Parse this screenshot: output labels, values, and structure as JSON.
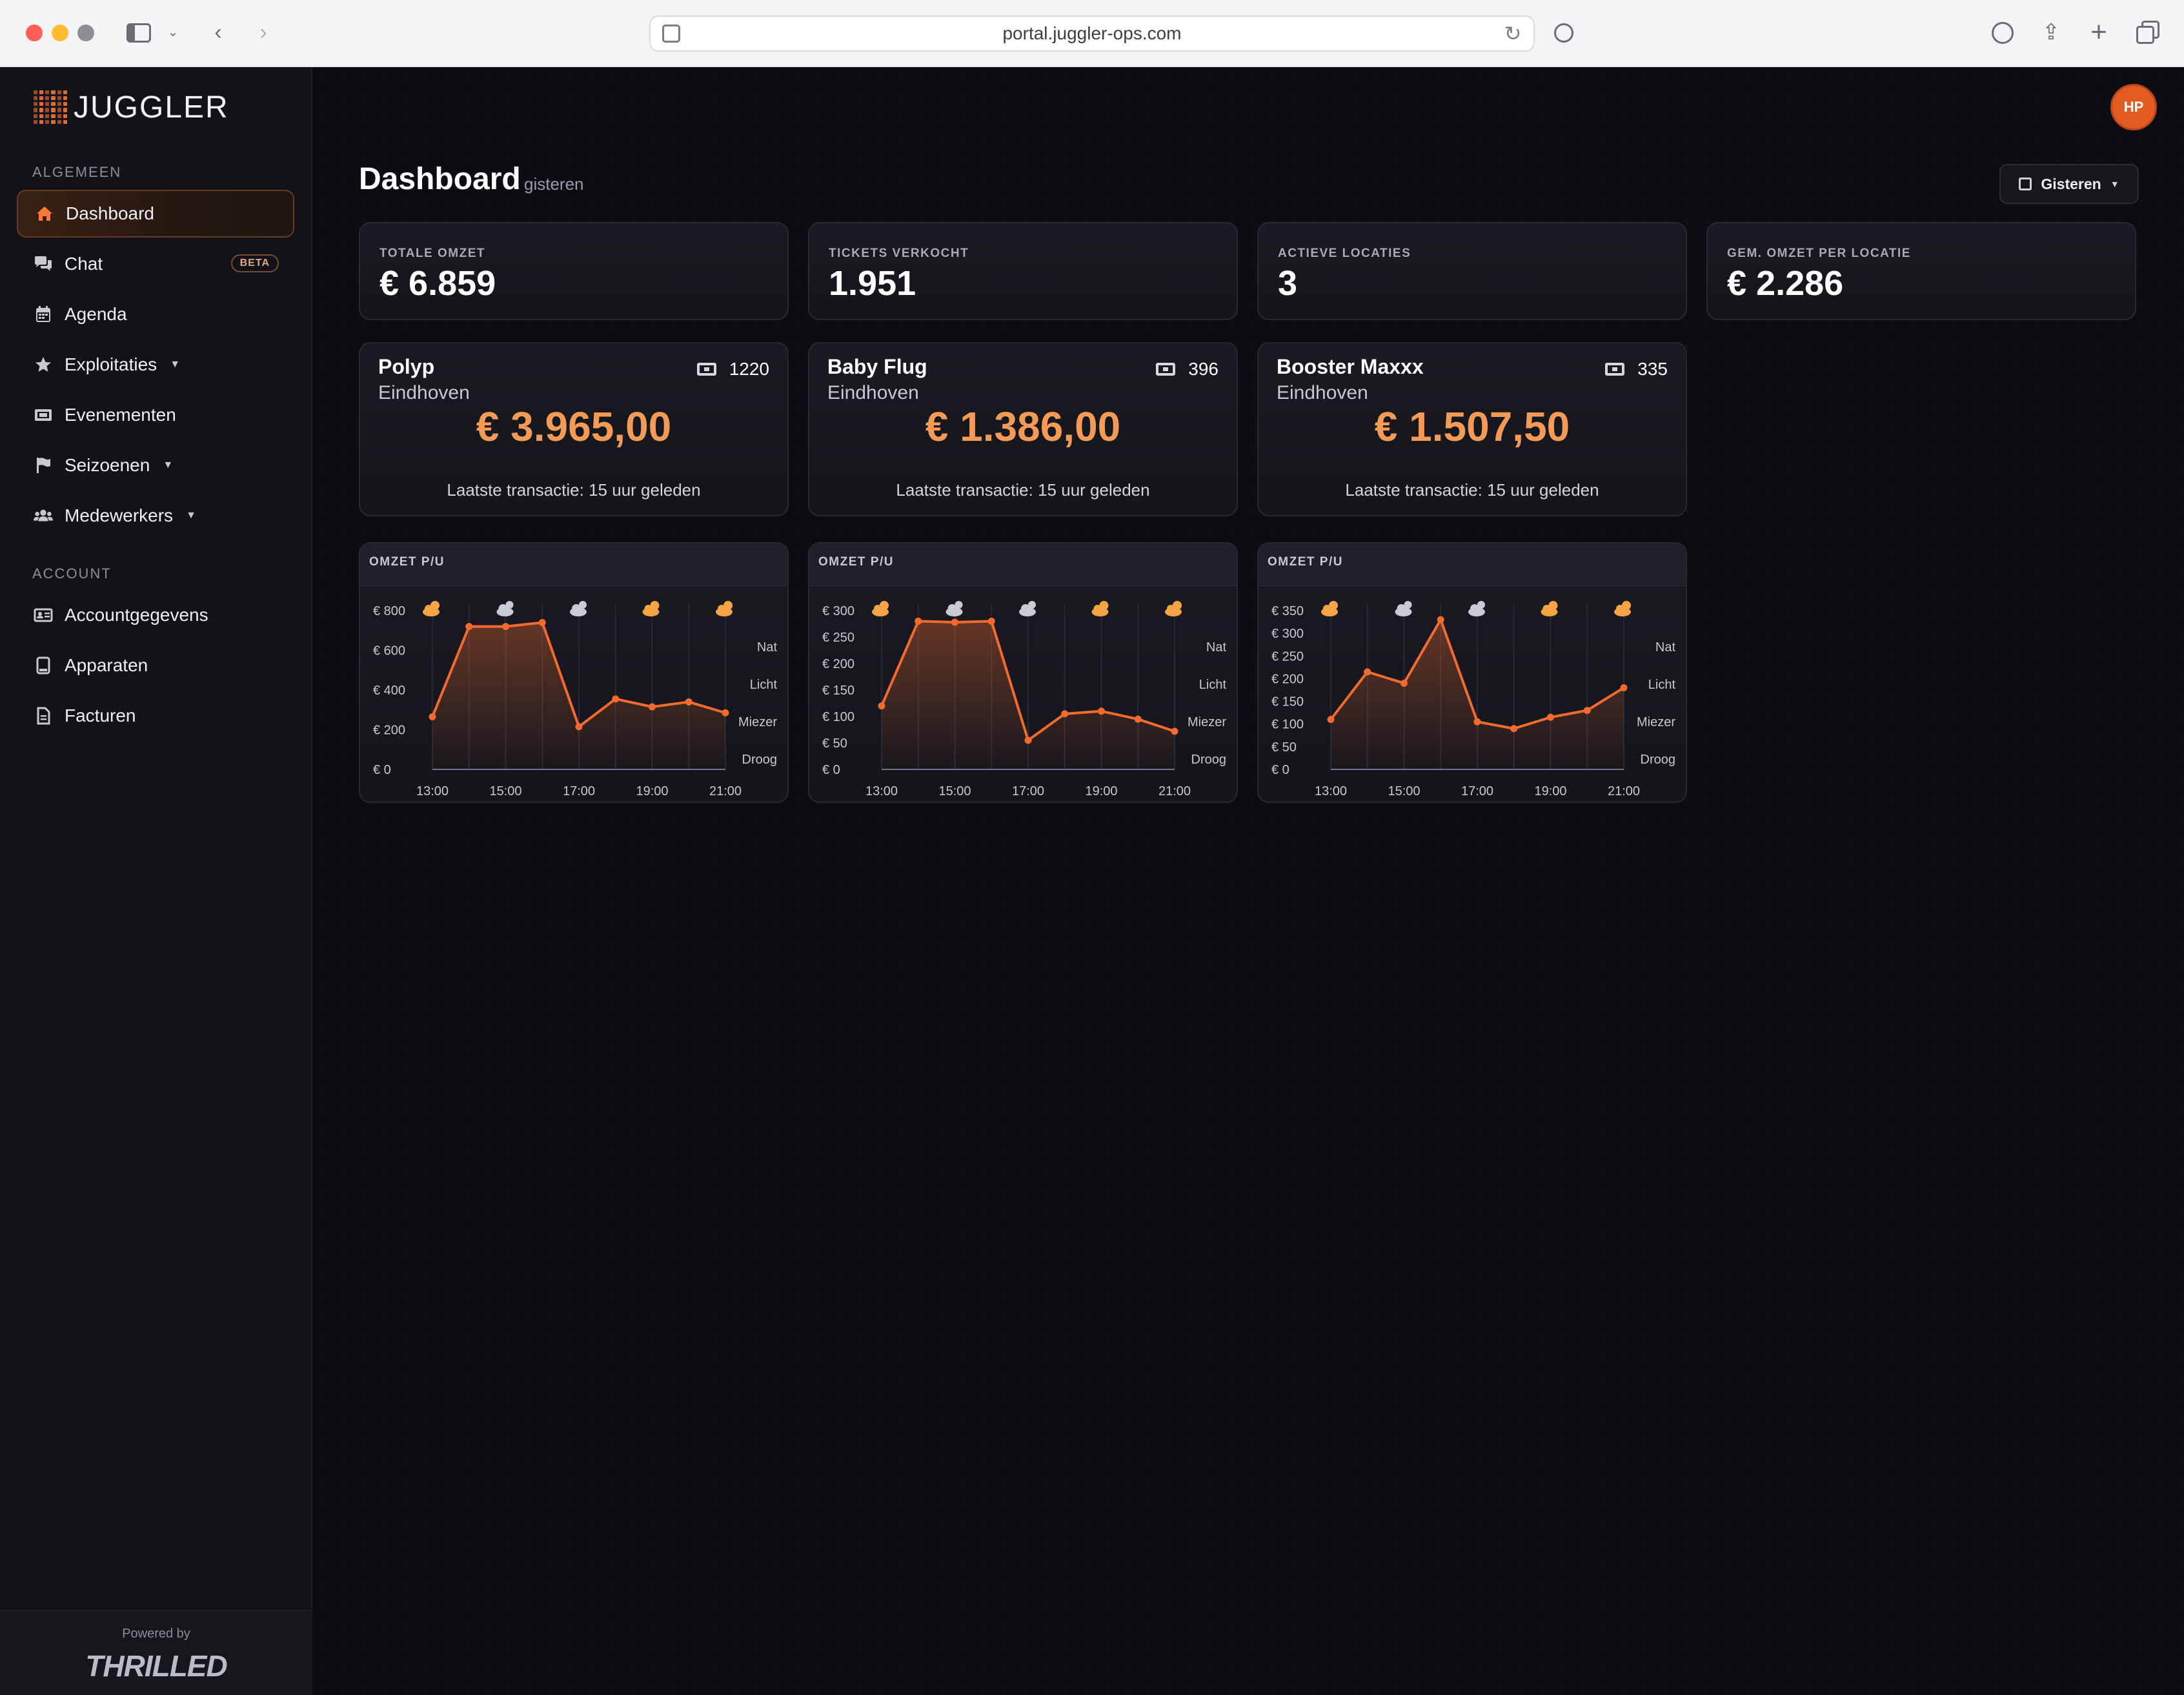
{
  "browser": {
    "url": "portal.juggler-ops.com"
  },
  "sidebar": {
    "logo": "JUGGLER",
    "sections": [
      {
        "title": "ALGEMEEN",
        "items": [
          {
            "label": "Dashboard",
            "icon": "home-icon",
            "active": true
          },
          {
            "label": "Chat",
            "icon": "chat-icon",
            "badge": "BETA"
          },
          {
            "label": "Agenda",
            "icon": "calendar-icon"
          },
          {
            "label": "Exploitaties",
            "icon": "star-icon",
            "dropdown": true
          },
          {
            "label": "Evenementen",
            "icon": "ticket-icon"
          },
          {
            "label": "Seizoenen",
            "icon": "flag-icon",
            "dropdown": true
          },
          {
            "label": "Medewerkers",
            "icon": "users-icon",
            "dropdown": true
          }
        ]
      },
      {
        "title": "ACCOUNT",
        "items": [
          {
            "label": "Accountgegevens",
            "icon": "id-card-icon"
          },
          {
            "label": "Apparaten",
            "icon": "tablet-icon"
          },
          {
            "label": "Facturen",
            "icon": "invoice-icon"
          }
        ]
      }
    ],
    "footer": {
      "powered_by": "Powered by",
      "brand": "THRILLED"
    }
  },
  "header": {
    "avatar_initials": "HP",
    "title": "Dashboard",
    "subtitle": "gisteren",
    "date_button": "Gisteren"
  },
  "kpis": [
    {
      "label": "TOTALE OMZET",
      "value": "€ 6.859"
    },
    {
      "label": "TICKETS VERKOCHT",
      "value": "1.951"
    },
    {
      "label": "ACTIEVE LOCATIES",
      "value": "3"
    },
    {
      "label": "GEM. OMZET PER LOCATIE",
      "value": "€ 2.286"
    }
  ],
  "locations": [
    {
      "name": "Polyp",
      "city": "Eindhoven",
      "tickets": "1220",
      "amount": "€ 3.965,00",
      "last_transaction": "Laatste transactie: 15 uur geleden"
    },
    {
      "name": "Baby Flug",
      "city": "Eindhoven",
      "tickets": "396",
      "amount": "€ 1.386,00",
      "last_transaction": "Laatste transactie: 15 uur geleden"
    },
    {
      "name": "Booster Maxxx",
      "city": "Eindhoven",
      "tickets": "335",
      "amount": "€ 1.507,50",
      "last_transaction": "Laatste transactie: 15 uur geleden"
    }
  ],
  "colors": {
    "accent": "#f39a57",
    "line": "#f26a2e",
    "weather_sun": "#f5a445",
    "weather_cloud": "#c8cad4"
  },
  "chart_data": [
    {
      "type": "area",
      "title": "OMZET P/U",
      "x": [
        "13:00",
        "14:00",
        "15:00",
        "16:00",
        "17:00",
        "18:00",
        "19:00",
        "20:00",
        "21:00"
      ],
      "x_tick_labels": [
        "13:00",
        "15:00",
        "17:00",
        "19:00",
        "21:00"
      ],
      "values": [
        265,
        720,
        720,
        740,
        215,
        355,
        315,
        340,
        285
      ],
      "ylim": [
        0,
        800
      ],
      "y_ticks": [
        0,
        200,
        400,
        600,
        800
      ],
      "y_tick_labels": [
        "€ 0",
        "€ 200",
        "€ 400",
        "€ 600",
        "€ 800"
      ],
      "weather_scale": [
        "Nat",
        "Licht",
        "Miezer",
        "Droog"
      ],
      "weather_icons": [
        "sun-cloud-icon",
        "cloud-sun-icon",
        "cloud-sun-icon",
        "sun-cloud-icon",
        "sun-cloud-icon"
      ],
      "grid": true
    },
    {
      "type": "area",
      "title": "OMZET P/U",
      "x": [
        "13:00",
        "14:00",
        "15:00",
        "16:00",
        "17:00",
        "18:00",
        "19:00",
        "20:00",
        "21:00"
      ],
      "x_tick_labels": [
        "13:00",
        "15:00",
        "17:00",
        "19:00",
        "21:00"
      ],
      "values": [
        120,
        280,
        278,
        280,
        55,
        105,
        110,
        95,
        72
      ],
      "ylim": [
        0,
        300
      ],
      "y_ticks": [
        0,
        50,
        100,
        150,
        200,
        250,
        300
      ],
      "y_tick_labels": [
        "€ 0",
        "€ 50",
        "€ 100",
        "€ 150",
        "€ 200",
        "€ 250",
        "€ 300"
      ],
      "weather_scale": [
        "Nat",
        "Licht",
        "Miezer",
        "Droog"
      ],
      "weather_icons": [
        "sun-cloud-icon",
        "cloud-sun-icon",
        "cloud-sun-icon",
        "sun-cloud-icon",
        "sun-cloud-icon"
      ],
      "grid": true
    },
    {
      "type": "area",
      "title": "OMZET P/U",
      "x": [
        "13:00",
        "14:00",
        "15:00",
        "16:00",
        "17:00",
        "18:00",
        "19:00",
        "20:00",
        "21:00"
      ],
      "x_tick_labels": [
        "13:00",
        "15:00",
        "17:00",
        "19:00",
        "21:00"
      ],
      "values": [
        110,
        215,
        190,
        330,
        105,
        90,
        115,
        130,
        180
      ],
      "ylim": [
        0,
        350
      ],
      "y_ticks": [
        0,
        50,
        100,
        150,
        200,
        250,
        300,
        350
      ],
      "y_tick_labels": [
        "€ 0",
        "€ 50",
        "€ 100",
        "€ 150",
        "€ 200",
        "€ 250",
        "€ 300",
        "€ 350"
      ],
      "weather_scale": [
        "Nat",
        "Licht",
        "Miezer",
        "Droog"
      ],
      "weather_icons": [
        "sun-cloud-icon",
        "cloud-sun-icon",
        "cloud-sun-icon",
        "sun-cloud-icon",
        "sun-cloud-icon"
      ],
      "grid": true
    }
  ]
}
